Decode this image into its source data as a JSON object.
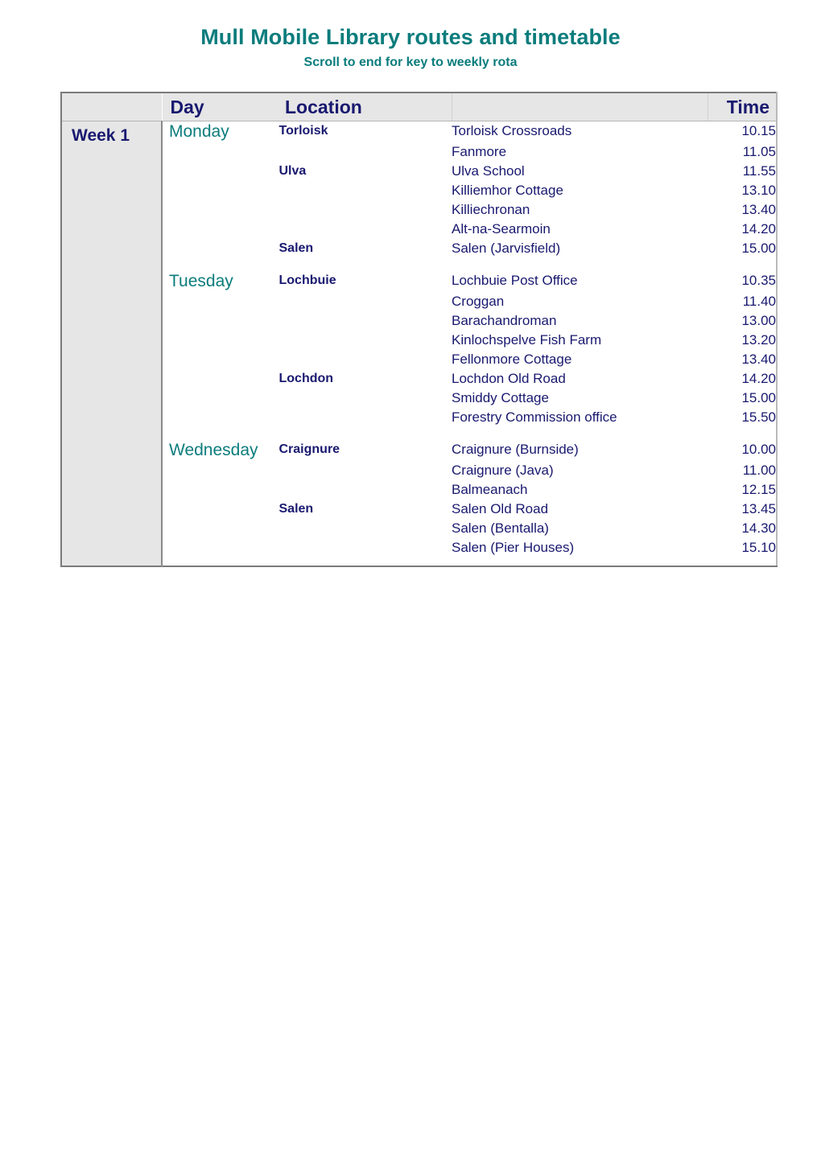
{
  "header": {
    "title": "Mull Mobile Library routes and timetable",
    "subtitle": "Scroll to end for key to weekly rota"
  },
  "colors": {
    "title_teal": "#0b7c7c",
    "body_navy": "#191970",
    "week_column_bg": "#e6e6e6",
    "header_row_bg": "#e6e6e6"
  },
  "table": {
    "columns": {
      "week": "",
      "day": "Day",
      "location": "Location",
      "stop": "",
      "time": "Time"
    },
    "week_label": "Week 1",
    "days": [
      {
        "day": "Monday",
        "rows": [
          {
            "location": "Torloisk",
            "stop": "Torloisk Crossroads",
            "time": "10.15"
          },
          {
            "location": "",
            "stop": "Fanmore",
            "time": "11.05"
          },
          {
            "location": "Ulva",
            "stop": "Ulva School",
            "time": "11.55"
          },
          {
            "location": "",
            "stop": "Killiemhor Cottage",
            "time": "13.10"
          },
          {
            "location": "",
            "stop": "Killiechronan",
            "time": "13.40"
          },
          {
            "location": "",
            "stop": "Alt-na-Searmoin",
            "time": "14.20"
          },
          {
            "location": "Salen",
            "stop": "Salen (Jarvisfield)",
            "time": "15.00"
          }
        ]
      },
      {
        "day": "Tuesday",
        "rows": [
          {
            "location": "Lochbuie",
            "stop": "Lochbuie Post Office",
            "time": "10.35"
          },
          {
            "location": "",
            "stop": "Croggan",
            "time": "11.40"
          },
          {
            "location": "",
            "stop": "Barachandroman",
            "time": "13.00"
          },
          {
            "location": "",
            "stop": "Kinlochspelve Fish Farm",
            "time": "13.20"
          },
          {
            "location": "",
            "stop": "Fellonmore Cottage",
            "time": "13.40"
          },
          {
            "location": "Lochdon",
            "stop": "Lochdon Old Road",
            "time": "14.20"
          },
          {
            "location": "",
            "stop": "Smiddy Cottage",
            "time": "15.00"
          },
          {
            "location": "",
            "stop": "Forestry Commission office",
            "time": "15.50"
          }
        ]
      },
      {
        "day": "Wednesday",
        "rows": [
          {
            "location": "Craignure",
            "stop": "Craignure (Burnside)",
            "time": "10.00"
          },
          {
            "location": "",
            "stop": "Craignure (Java)",
            "time": "11.00"
          },
          {
            "location": "",
            "stop": "Balmeanach",
            "time": "12.15"
          },
          {
            "location": "Salen",
            "stop": "Salen Old Road",
            "time": "13.45"
          },
          {
            "location": "",
            "stop": "Salen (Bentalla)",
            "time": "14.30"
          },
          {
            "location": "",
            "stop": "Salen (Pier Houses)",
            "time": "15.10"
          }
        ]
      }
    ]
  }
}
